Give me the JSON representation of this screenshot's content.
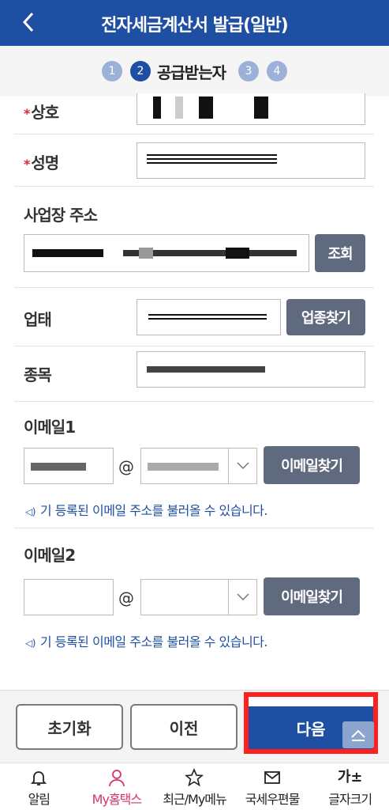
{
  "header": {
    "title": "전자세금계산서 발급(일반)"
  },
  "steps": {
    "s1": "1",
    "s2": "2",
    "s2_label": "공급받는자",
    "s3": "3",
    "s4": "4"
  },
  "form": {
    "company_label": "상호",
    "name_label": "성명",
    "required_mark": "*",
    "address_label": "사업장 주소",
    "address_search": "조회",
    "business_type_label": "업태",
    "business_type_search": "업종찾기",
    "item_label": "종목",
    "email1_label": "이메일1",
    "email2_label": "이메일2",
    "at": "@",
    "email_search": "이메일찾기",
    "email_hint": "기 등록된 이메일 주소를 불러올 수 있습니다."
  },
  "footer": {
    "reset": "초기화",
    "prev": "이전",
    "next": "다음"
  },
  "tabs": [
    {
      "label": "알림",
      "icon": "bell-icon"
    },
    {
      "label": "My홈택스",
      "icon": "person-icon"
    },
    {
      "label": "최근/My메뉴",
      "icon": "star-icon"
    },
    {
      "label": "국세우편물",
      "icon": "mail-icon"
    },
    {
      "label": "글자크기",
      "icon": "font-size-icon",
      "glyph": "가±"
    }
  ],
  "colors": {
    "brand": "#1f4fa3",
    "active_tab": "#d6336c",
    "required": "#d8283a"
  }
}
